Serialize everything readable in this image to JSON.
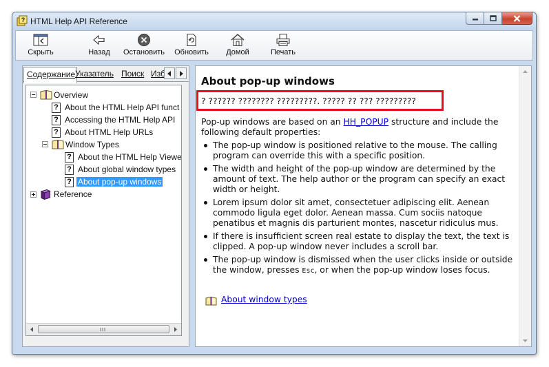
{
  "window": {
    "title": "HTML Help API Reference"
  },
  "toolbar": {
    "hide_label": "Скрыть",
    "back_label": "Назад",
    "stop_label": "Остановить",
    "refresh_label": "Обновить",
    "home_label": "Домой",
    "print_label": "Печать"
  },
  "tabs": {
    "contents": "Содержание",
    "index": "Указатель",
    "search": "Поиск",
    "favorites": "Изб"
  },
  "tree": {
    "overview": "Overview",
    "items": [
      "About the HTML Help API funct",
      "Accessing the HTML Help API",
      "About HTML Help URLs"
    ],
    "window_types": "Window Types",
    "window_items": [
      "About the HTML Help Viewe",
      "About global window types",
      "About pop-up windows"
    ],
    "reference": "Reference"
  },
  "topic": {
    "title": "About pop-up windows",
    "highlight_text": "? ?????? ???????? ?????????. ????? ?? ??? ?????????",
    "intro_before": "Pop-up windows are based on an ",
    "intro_link": "HH_POPUP",
    "intro_after": " structure and include the following default properties:",
    "bullets": [
      "The pop-up window is positioned relative to the mouse. The calling program can override this with a specific position.",
      "The width and height of the pop-up window are determined by the amount of text. The help author or the program can specify an exact width or height.",
      "Lorem ipsum dolor sit amet, consectetuer adipiscing elit. Aenean commodo ligula eget dolor. Aenean massa. Cum sociis natoque penatibus et magnis dis parturient montes, nascetur ridiculus mus.",
      "If there is insufficient screen real estate to display the text, the text is clipped. A pop-up window never includes a scroll bar."
    ],
    "last_bullet_before": "The pop-up window is dismissed when the user clicks inside or outside the window, presses ",
    "last_bullet_key": "Esc",
    "last_bullet_after": ", or when the pop-up window loses focus.",
    "related_link": "About window types"
  },
  "colors": {
    "highlight_border": "#e2101a",
    "selection": "#3399ff",
    "link": "#0000cc"
  }
}
